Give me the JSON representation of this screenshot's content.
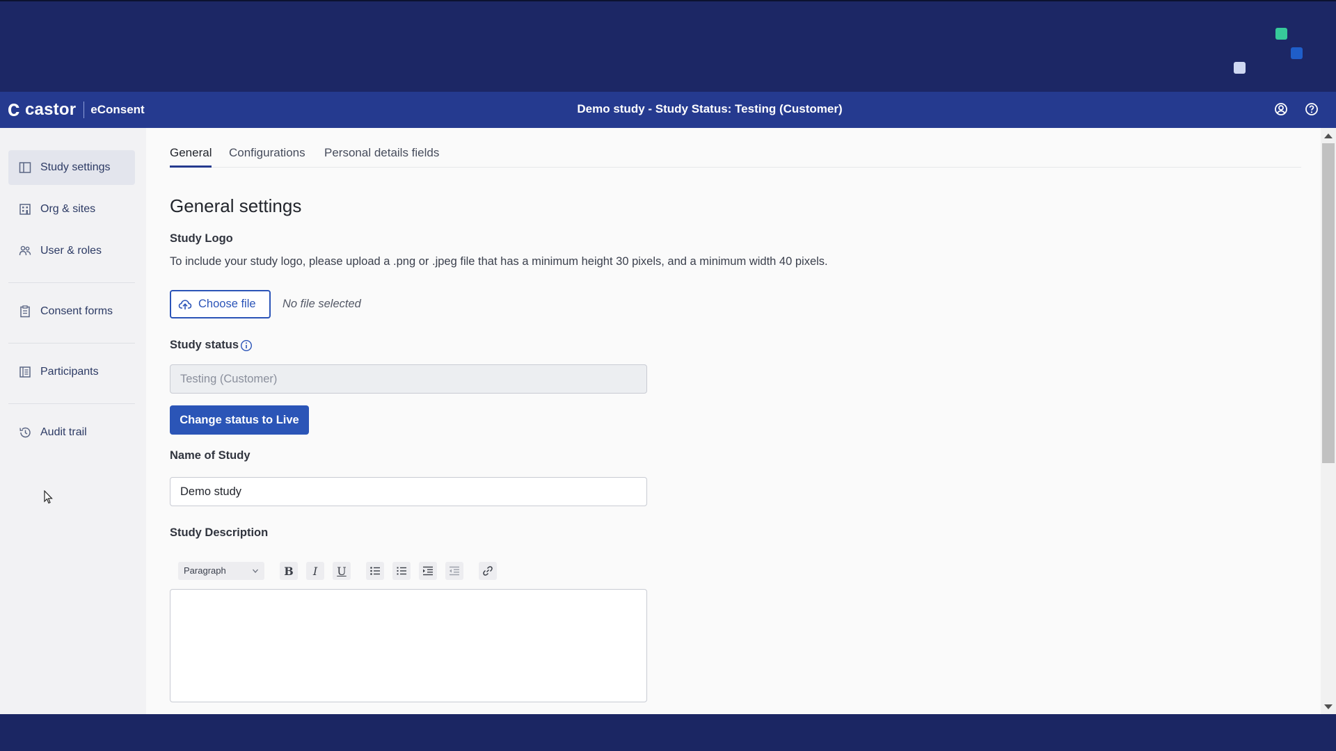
{
  "brand": {
    "name": "castor",
    "product": "eConsent"
  },
  "header": {
    "title": "Demo study  - Study Status: Testing (Customer)"
  },
  "sidebar": {
    "items": [
      {
        "label": "Study settings",
        "icon": "layout-icon",
        "active": true
      },
      {
        "label": "Org & sites",
        "icon": "building-icon",
        "active": false
      },
      {
        "label": "User & roles",
        "icon": "users-icon",
        "active": false
      },
      {
        "label": "Consent forms",
        "icon": "clipboard-icon",
        "active": false
      },
      {
        "label": "Participants",
        "icon": "list-icon",
        "active": false
      },
      {
        "label": "Audit trail",
        "icon": "history-icon",
        "active": false
      }
    ]
  },
  "tabs": [
    {
      "label": "General",
      "active": true
    },
    {
      "label": "Configurations",
      "active": false
    },
    {
      "label": "Personal details fields",
      "active": false
    }
  ],
  "main": {
    "heading": "General settings",
    "study_logo": {
      "label": "Study Logo",
      "help": "To include your study logo, please upload a .png or .jpeg file that has a minimum height 30 pixels, and a minimum width 40 pixels.",
      "button": "Choose file",
      "no_file": "No file selected"
    },
    "study_status": {
      "label": "Study status",
      "value": "Testing (Customer)",
      "button": "Change status to Live"
    },
    "study_name": {
      "label": "Name of Study",
      "value": "Demo study"
    },
    "study_description": {
      "label": "Study Description",
      "format_select": "Paragraph",
      "toolbar": [
        {
          "name": "bold-icon",
          "glyph": "B"
        },
        {
          "name": "italic-icon",
          "glyph": "I"
        },
        {
          "name": "underline-icon",
          "glyph": "U"
        },
        {
          "name": "bulleted-list-icon",
          "glyph": ""
        },
        {
          "name": "numbered-list-icon",
          "glyph": ""
        },
        {
          "name": "indent-icon",
          "glyph": ""
        },
        {
          "name": "outdent-icon",
          "glyph": ""
        },
        {
          "name": "link-icon",
          "glyph": ""
        }
      ],
      "value": ""
    }
  },
  "colors": {
    "header_bg": "#253a8f",
    "band_bg": "#1c2765",
    "primary": "#2b55b7",
    "accent_green": "#37c99a"
  }
}
